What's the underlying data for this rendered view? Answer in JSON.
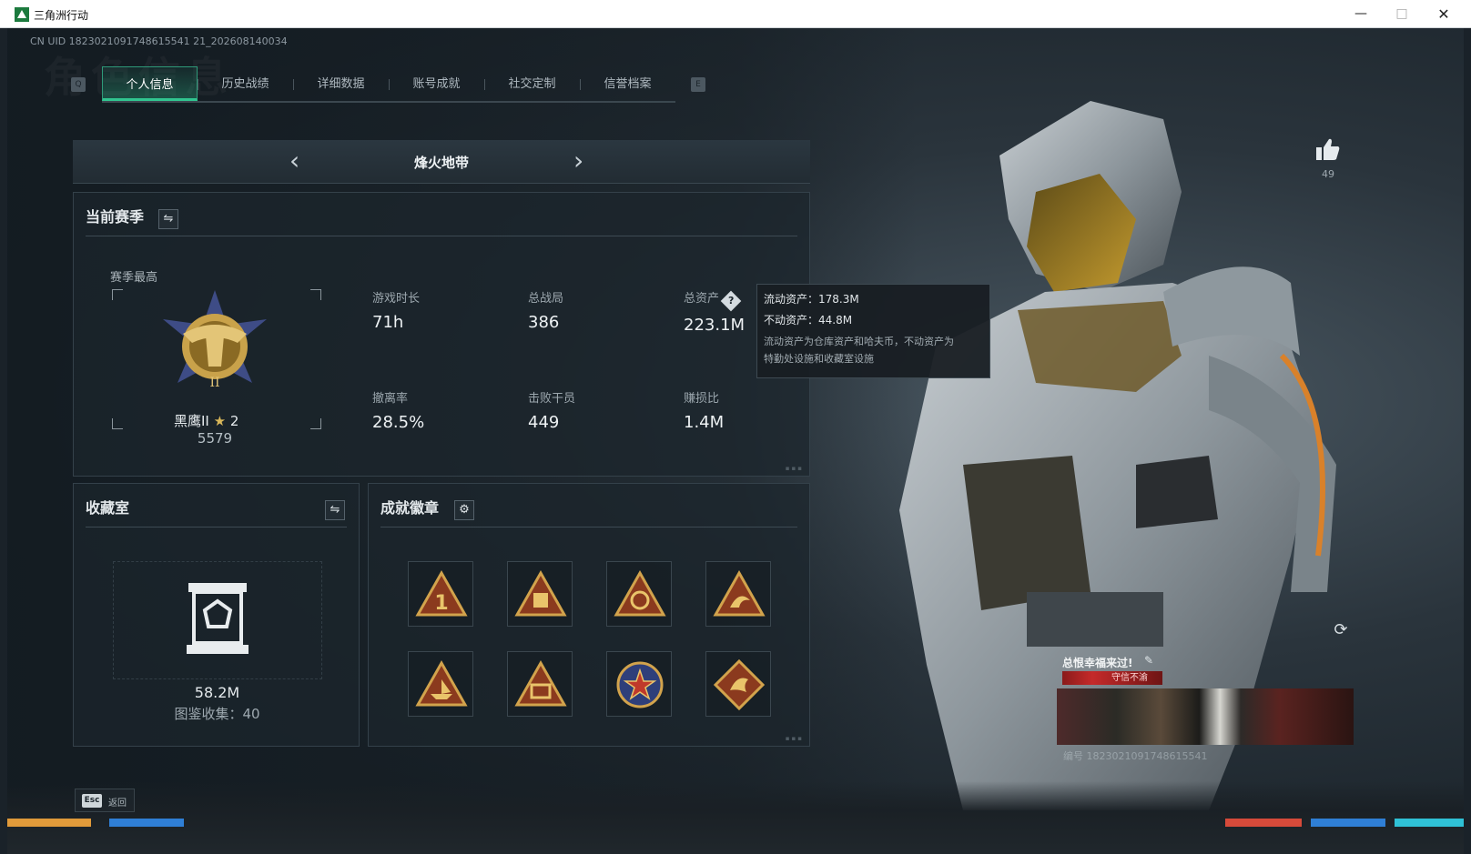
{
  "window": {
    "title": "三角洲行动",
    "minimize": "—",
    "maximize": "□",
    "close": "✕"
  },
  "uid": "CN UID 1823021091748615541 21_202608140034",
  "tabs": {
    "key_left": "Q",
    "key_right": "E",
    "items": [
      "个人信息",
      "历史战绩",
      "详细数据",
      "账号成就",
      "社交定制",
      "信誉档案"
    ],
    "active": "个人信息"
  },
  "season_nav": {
    "prev": "‹",
    "next": "›",
    "name": "烽火地带"
  },
  "current_season": {
    "title": "当前赛季",
    "best_label": "赛季最高",
    "rank_name": "黑鹰II",
    "rank_stars": "2",
    "rank_score": "5579",
    "stats": [
      {
        "label": "游戏时长",
        "value": "71h"
      },
      {
        "label": "总战局",
        "value": "386"
      },
      {
        "label": "总资产",
        "value": "223.1M"
      },
      {
        "label": "撤离率",
        "value": "28.5%"
      },
      {
        "label": "击败干员",
        "value": "449"
      },
      {
        "label": "赚损比",
        "value": "1.4M"
      }
    ]
  },
  "assets_tooltip": {
    "liquid": "流动资产：178.3M",
    "fixed": "不动资产：44.8M",
    "note_line1": "流动资产为仓库资产和哈夫币，不动资产为",
    "note_line2": "特勤处设施和收藏室设施"
  },
  "collection": {
    "title": "收藏室",
    "value": "58.2M",
    "count": "图鉴收集：40"
  },
  "badges": {
    "title": "成就徽章",
    "items": [
      "badge-1",
      "badge-crate",
      "badge-emblem",
      "badge-fox",
      "badge-boat",
      "badge-case",
      "badge-star",
      "badge-dragon"
    ]
  },
  "likes": {
    "count": "49"
  },
  "signature": {
    "text": "总恨幸福来过!",
    "banner": "守信不渝",
    "id": "编号 1823021091748615541"
  },
  "footer": {
    "esc_key": "Esc",
    "esc_label": "返回"
  },
  "colors": {
    "accent": "#31c590",
    "gold": "#c9a24a",
    "bg": "#1b242b"
  }
}
